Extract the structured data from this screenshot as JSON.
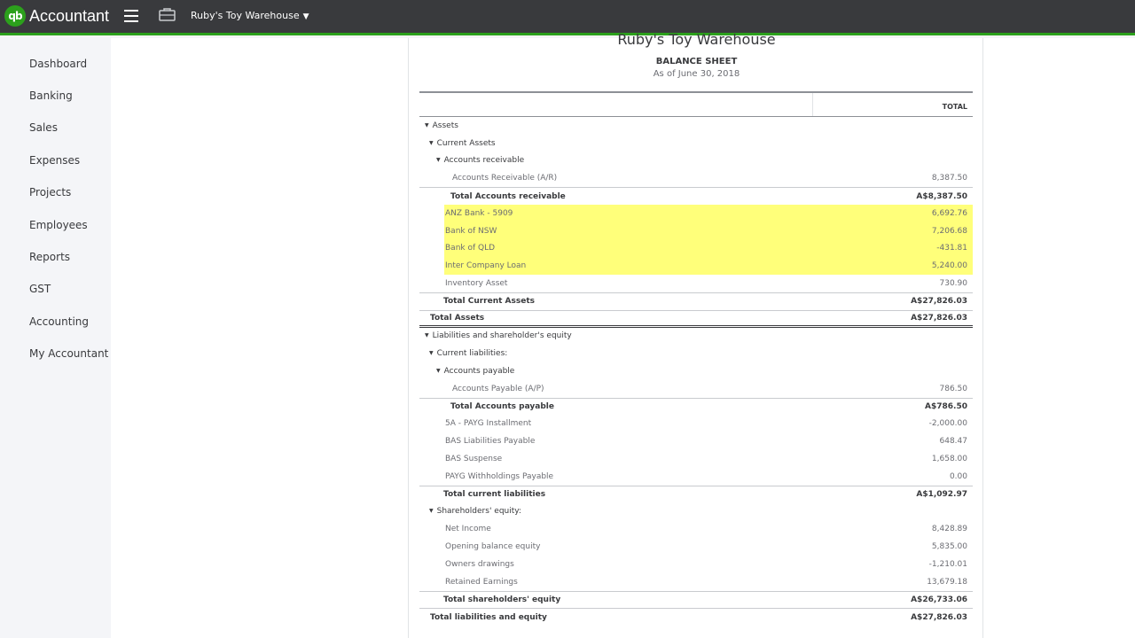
{
  "topbar": {
    "logo_text": "qb",
    "app_name": "Accountant",
    "company_name": "Ruby's Toy Warehouse",
    "brand_color": "#2ca01c"
  },
  "sidebar": {
    "items": [
      {
        "label": "Dashboard"
      },
      {
        "label": "Banking"
      },
      {
        "label": "Sales"
      },
      {
        "label": "Expenses"
      },
      {
        "label": "Projects"
      },
      {
        "label": "Employees"
      },
      {
        "label": "Reports"
      },
      {
        "label": "GST"
      },
      {
        "label": "Accounting"
      },
      {
        "label": "My Accountant"
      }
    ]
  },
  "report": {
    "company": "Ruby's Toy Warehouse",
    "title": "BALANCE SHEET",
    "date": "As of June 30, 2018",
    "column_header": "TOTAL",
    "highlight_color": "#ffff7a",
    "rows": [
      {
        "label": "Assets",
        "value": ""
      },
      {
        "label": "Current Assets",
        "value": ""
      },
      {
        "label": "Accounts receivable",
        "value": ""
      },
      {
        "label": "Accounts Receivable (A/R)",
        "value": "8,387.50"
      },
      {
        "label": "Total Accounts receivable",
        "value": "A$8,387.50"
      },
      {
        "label": "ANZ Bank - 5909",
        "value": "6,692.76"
      },
      {
        "label": "Bank of NSW",
        "value": "7,206.68"
      },
      {
        "label": "Bank of QLD",
        "value": "-431.81"
      },
      {
        "label": "Inter Company Loan",
        "value": "5,240.00"
      },
      {
        "label": "Inventory Asset",
        "value": "730.90"
      },
      {
        "label": "Total Current Assets",
        "value": "A$27,826.03"
      },
      {
        "label": "Total Assets",
        "value": "A$27,826.03"
      },
      {
        "label": "Liabilities and shareholder's equity",
        "value": ""
      },
      {
        "label": "Current liabilities:",
        "value": ""
      },
      {
        "label": "Accounts payable",
        "value": ""
      },
      {
        "label": "Accounts Payable (A/P)",
        "value": "786.50"
      },
      {
        "label": "Total Accounts payable",
        "value": "A$786.50"
      },
      {
        "label": "5A - PAYG Installment",
        "value": "-2,000.00"
      },
      {
        "label": "BAS Liabilities Payable",
        "value": "648.47"
      },
      {
        "label": "BAS Suspense",
        "value": "1,658.00"
      },
      {
        "label": "PAYG Withholdings Payable",
        "value": "0.00"
      },
      {
        "label": "Total current liabilities",
        "value": "A$1,092.97"
      },
      {
        "label": "Shareholders' equity:",
        "value": ""
      },
      {
        "label": "Net Income",
        "value": "8,428.89"
      },
      {
        "label": "Opening balance equity",
        "value": "5,835.00"
      },
      {
        "label": "Owners drawings",
        "value": "-1,210.01"
      },
      {
        "label": "Retained Earnings",
        "value": "13,679.18"
      },
      {
        "label": "Total shareholders' equity",
        "value": "A$26,733.06"
      },
      {
        "label": "Total liabilities and equity",
        "value": "A$27,826.03"
      }
    ]
  }
}
